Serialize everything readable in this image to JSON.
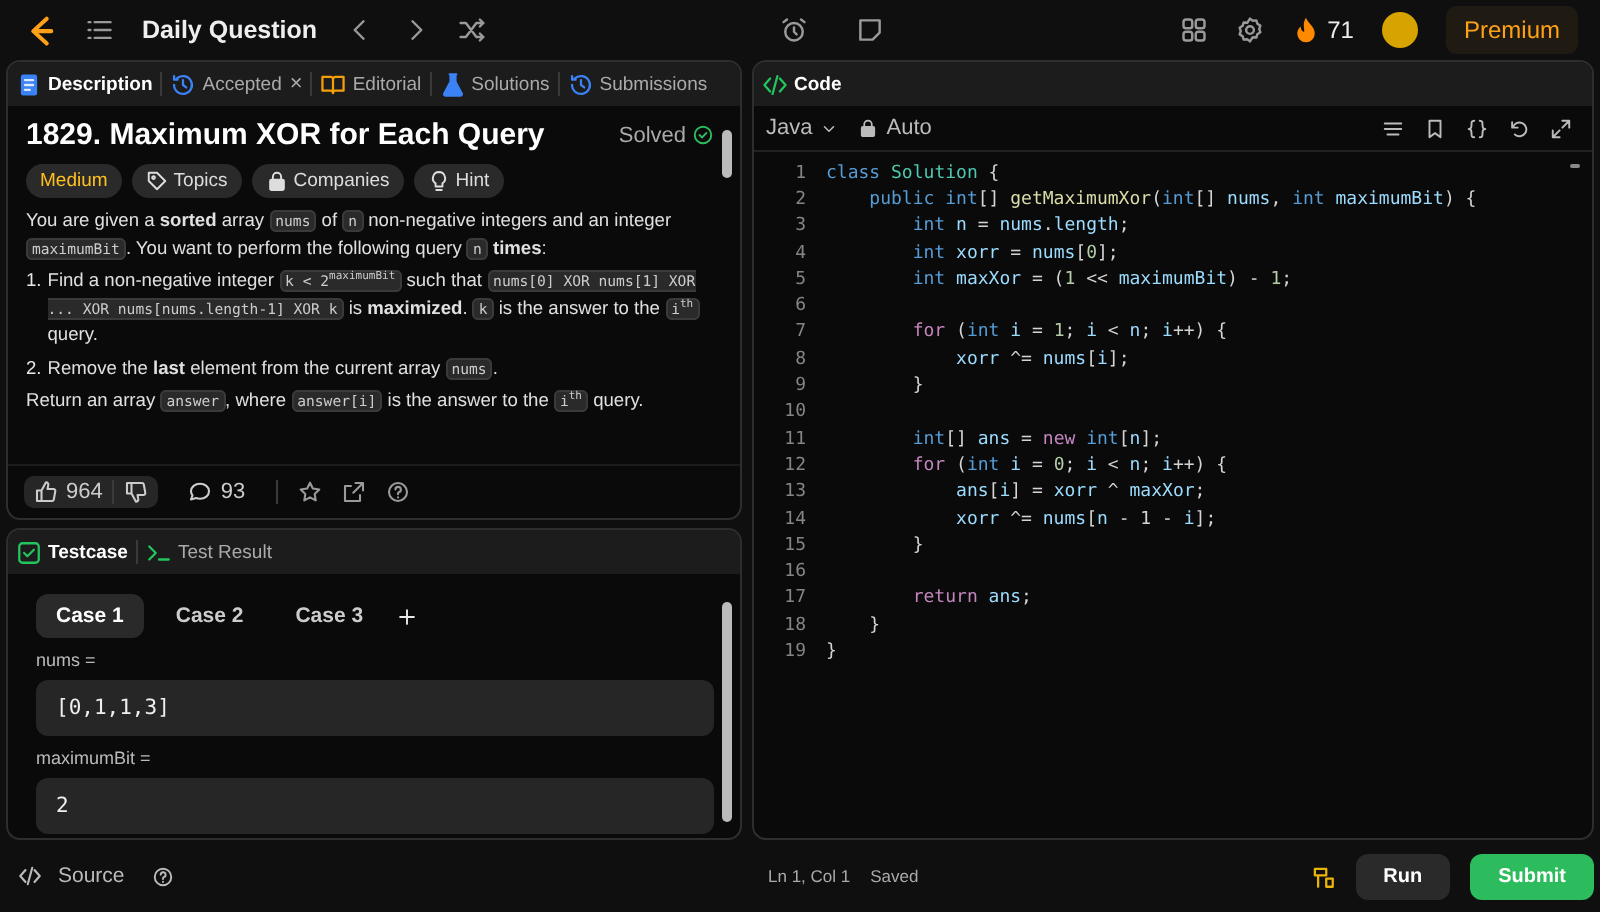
{
  "top_bar": {
    "title": "Daily Question",
    "streak": "71",
    "premium": "Premium"
  },
  "description_tabs": [
    {
      "label": "Description",
      "selected": true
    },
    {
      "label": "Accepted",
      "selected": false,
      "close": "×"
    },
    {
      "label": "Editorial",
      "selected": false
    },
    {
      "label": "Solutions",
      "selected": false
    },
    {
      "label": "Submissions",
      "selected": false
    }
  ],
  "problem": {
    "title": "1829. Maximum XOR for Each Query",
    "status": "Solved",
    "difficulty": "Medium",
    "tags": [
      {
        "label": "Topics"
      },
      {
        "label": "Companies"
      },
      {
        "label": "Hint"
      }
    ],
    "paragraphs": [
      {
        "kind": "text",
        "segments": [
          {
            "kind": "text",
            "text": "You are given a **sorted** array "
          },
          {
            "kind": "code",
            "text": "nums"
          },
          {
            "kind": "text",
            "text": " of "
          },
          {
            "kind": "code",
            "text": "n"
          },
          {
            "kind": "text",
            "text": " non-negative integers and an integer "
          },
          {
            "kind": "code",
            "text": "maximumBit"
          },
          {
            "kind": "text",
            "text": ". You want to perform the following query "
          },
          {
            "kind": "code",
            "text": "n"
          },
          {
            "kind": "text",
            "text": " **times**:"
          }
        ]
      },
      {
        "kind": "list_item",
        "number": "1.",
        "segments": [
          {
            "kind": "text",
            "text": "Find a non-negative integer "
          },
          {
            "kind": "code",
            "text": "k < 2$^{maximumBit}$"
          },
          {
            "kind": "text",
            "text": " such that "
          },
          {
            "kind": "code",
            "text": "nums[0] XOR nums[1] XOR ... XOR nums[nums.length-1] XOR k"
          },
          {
            "kind": "text",
            "text": " is **maximized**. "
          },
          {
            "kind": "code",
            "text": "k"
          },
          {
            "kind": "text",
            "text": " is the answer to the "
          },
          {
            "kind": "code",
            "text": "i$^{th}$"
          },
          {
            "kind": "text",
            "text": " query."
          }
        ]
      },
      {
        "kind": "list_item",
        "number": "2.",
        "segments": [
          {
            "kind": "text",
            "text": "Remove the **last** element from the current array "
          },
          {
            "kind": "code",
            "text": "nums"
          },
          {
            "kind": "text",
            "text": "."
          }
        ]
      },
      {
        "kind": "text",
        "segments": [
          {
            "kind": "text",
            "text": "Return an array "
          },
          {
            "kind": "code",
            "text": "answer"
          },
          {
            "kind": "text",
            "text": ", where "
          },
          {
            "kind": "code",
            "text": "answer[i]"
          },
          {
            "kind": "text",
            "text": " is the answer to the "
          },
          {
            "kind": "code",
            "text": "i$^{th}$"
          },
          {
            "kind": "text",
            "text": " query."
          }
        ]
      }
    ],
    "likes": "964",
    "comments": "93"
  },
  "code_panel": {
    "title": "Code",
    "language": "Java",
    "mode": "Auto",
    "lines": [
      {
        "number": "1",
        "tokens": [
          {
            "t": "class ",
            "color": "#569cd6"
          },
          {
            "t": "Solution",
            "color": "#4ec9b0"
          },
          {
            "t": " {",
            "color": "#d4d4d4"
          }
        ]
      },
      {
        "number": "2",
        "tokens": [
          {
            "t": "    public int",
            "color": "#569cd6"
          },
          {
            "t": "[] ",
            "color": "#d4d4d4"
          },
          {
            "t": "getMaximumXor",
            "color": "#dcdcaa"
          },
          {
            "t": "(",
            "color": "#d4d4d4"
          },
          {
            "t": "int",
            "color": "#569cd6"
          },
          {
            "t": "[] ",
            "color": "#d4d4d4"
          },
          {
            "t": "nums",
            "color": "#9cdcfe"
          },
          {
            "t": ", ",
            "color": "#d4d4d4"
          },
          {
            "t": "int ",
            "color": "#569cd6"
          },
          {
            "t": "maximumBit",
            "color": "#9cdcfe"
          },
          {
            "t": ") {",
            "color": "#d4d4d4"
          }
        ]
      },
      {
        "number": "3",
        "tokens": [
          {
            "t": "        int ",
            "color": "#569cd6"
          },
          {
            "t": "n",
            "color": "#9cdcfe"
          },
          {
            "t": " = ",
            "color": "#d4d4d4"
          },
          {
            "t": "nums",
            "color": "#9cdcfe"
          },
          {
            "t": ".",
            "color": "#d4d4d4"
          },
          {
            "t": "length",
            "color": "#9cdcfe"
          },
          {
            "t": ";",
            "color": "#d4d4d4"
          }
        ]
      },
      {
        "number": "4",
        "tokens": [
          {
            "t": "        int ",
            "color": "#569cd6"
          },
          {
            "t": "xorr",
            "color": "#9cdcfe"
          },
          {
            "t": " = ",
            "color": "#d4d4d4"
          },
          {
            "t": "nums",
            "color": "#9cdcfe"
          },
          {
            "t": "[",
            "color": "#d4d4d4"
          },
          {
            "t": "0",
            "color": "#b5cea8"
          },
          {
            "t": "];",
            "color": "#d4d4d4"
          }
        ]
      },
      {
        "number": "5",
        "tokens": [
          {
            "t": "        int ",
            "color": "#569cd6"
          },
          {
            "t": "maxXor",
            "color": "#9cdcfe"
          },
          {
            "t": " = (",
            "color": "#d4d4d4"
          },
          {
            "t": "1",
            "color": "#b5cea8"
          },
          {
            "t": " << ",
            "color": "#d4d4d4"
          },
          {
            "t": "maximumBit",
            "color": "#9cdcfe"
          },
          {
            "t": ") - ",
            "color": "#d4d4d4"
          },
          {
            "t": "1",
            "color": "#b5cea8"
          },
          {
            "t": ";",
            "color": "#d4d4d4"
          }
        ]
      },
      {
        "number": "6"
      },
      {
        "number": "7",
        "tokens": [
          {
            "t": "        for",
            "color": "#c586c0"
          },
          {
            "t": " (",
            "color": "#d4d4d4"
          },
          {
            "t": "int ",
            "color": "#569cd6"
          },
          {
            "t": "i",
            "color": "#9cdcfe"
          },
          {
            "t": " = ",
            "color": "#d4d4d4"
          },
          {
            "t": "1",
            "color": "#b5cea8"
          },
          {
            "t": "; ",
            "color": "#d4d4d4"
          },
          {
            "t": "i",
            "color": "#9cdcfe"
          },
          {
            "t": " < ",
            "color": "#d4d4d4"
          },
          {
            "t": "n",
            "color": "#9cdcfe"
          },
          {
            "t": "; ",
            "color": "#d4d4d4"
          },
          {
            "t": "i",
            "color": "#9cdcfe"
          },
          {
            "t": "++) {",
            "color": "#d4d4d4"
          }
        ]
      },
      {
        "number": "8",
        "tokens": [
          {
            "t": "            xorr",
            "color": "#9cdcfe"
          },
          {
            "t": " ^= ",
            "color": "#d4d4d4"
          },
          {
            "t": "nums",
            "color": "#9cdcfe"
          },
          {
            "t": "[",
            "color": "#d4d4d4"
          },
          {
            "t": "i",
            "color": "#9cdcfe"
          },
          {
            "t": "];",
            "color": "#d4d4d4"
          }
        ]
      },
      {
        "number": "9",
        "tokens": [
          {
            "t": "        }",
            "color": "#d4d4d4"
          }
        ]
      },
      {
        "number": "10"
      },
      {
        "number": "11",
        "tokens": [
          {
            "t": "        int",
            "color": "#569cd6"
          },
          {
            "t": "[] ",
            "color": "#d4d4d4"
          },
          {
            "t": "ans",
            "color": "#9cdcfe"
          },
          {
            "t": " = ",
            "color": "#d4d4d4"
          },
          {
            "t": "new ",
            "color": "#c586c0"
          },
          {
            "t": "int",
            "color": "#569cd6"
          },
          {
            "t": "[",
            "color": "#d4d4d4"
          },
          {
            "t": "n",
            "color": "#9cdcfe"
          },
          {
            "t": "];",
            "color": "#d4d4d4"
          }
        ]
      },
      {
        "number": "12",
        "tokens": [
          {
            "t": "        for",
            "color": "#c586c0"
          },
          {
            "t": " (",
            "color": "#d4d4d4"
          },
          {
            "t": "int ",
            "color": "#569cd6"
          },
          {
            "t": "i",
            "color": "#9cdcfe"
          },
          {
            "t": " = ",
            "color": "#d4d4d4"
          },
          {
            "t": "0",
            "color": "#b5cea8"
          },
          {
            "t": "; ",
            "color": "#d4d4d4"
          },
          {
            "t": "i",
            "color": "#9cdcfe"
          },
          {
            "t": " < ",
            "color": "#d4d4d4"
          },
          {
            "t": "n",
            "color": "#9cdcfe"
          },
          {
            "t": "; ",
            "color": "#d4d4d4"
          },
          {
            "t": "i",
            "color": "#9cdcfe"
          },
          {
            "t": "++) {",
            "color": "#d4d4d4"
          }
        ]
      },
      {
        "number": "13",
        "tokens": [
          {
            "t": "            ans",
            "color": "#9cdcfe"
          },
          {
            "t": "[",
            "color": "#d4d4d4"
          },
          {
            "t": "i",
            "color": "#9cdcfe"
          },
          {
            "t": "] = ",
            "color": "#d4d4d4"
          },
          {
            "t": "xorr",
            "color": "#9cdcfe"
          },
          {
            "t": " ^ ",
            "color": "#d4d4d4"
          },
          {
            "t": "maxXor",
            "color": "#9cdcfe"
          },
          {
            "t": ";",
            "color": "#d4d4d4"
          }
        ]
      },
      {
        "number": "14",
        "tokens": [
          {
            "t": "            xorr",
            "color": "#9cdcfe"
          },
          {
            "t": " ^= ",
            "color": "#d4d4d4"
          },
          {
            "t": "nums",
            "color": "#9cdcfe"
          },
          {
            "t": "[",
            "color": "#d4d4d4"
          },
          {
            "t": "n",
            "color": "#9cdcfe"
          },
          {
            "t": " - 1 - ",
            "color": "#d4d4d4"
          },
          {
            "t": "i",
            "color": "#9cdcfe"
          },
          {
            "t": "];",
            "color": "#d4d4d4"
          }
        ]
      },
      {
        "number": "15",
        "tokens": [
          {
            "t": "        }",
            "color": "#d4d4d4"
          }
        ]
      },
      {
        "number": "16"
      },
      {
        "number": "17",
        "tokens": [
          {
            "t": "        return ",
            "color": "#c586c0"
          },
          {
            "t": "ans",
            "color": "#9cdcfe"
          },
          {
            "t": ";",
            "color": "#d4d4d4"
          }
        ]
      },
      {
        "number": "18",
        "tokens": [
          {
            "t": "    }",
            "color": "#d4d4d4"
          }
        ]
      },
      {
        "number": "19",
        "tokens": [
          {
            "t": "}",
            "color": "#d4d4d4"
          }
        ]
      }
    ]
  },
  "test_tabs": [
    {
      "label": "Testcase",
      "selected": true
    },
    {
      "label": "Test Result",
      "selected": false
    }
  ],
  "cases": [
    {
      "label": "Case 1",
      "selected": true
    },
    {
      "label": "Case 2",
      "selected": false
    },
    {
      "label": "Case 3",
      "selected": false
    }
  ],
  "inputs": [
    {
      "label": "nums =",
      "value": "[0,1,1,3]"
    },
    {
      "label": "maximumBit =",
      "value": "2"
    }
  ],
  "bottom_bar": {
    "source": "Source",
    "position": "Ln 1, Col 1",
    "save_state": "Saved",
    "run": "Run",
    "submit": "Submit"
  }
}
